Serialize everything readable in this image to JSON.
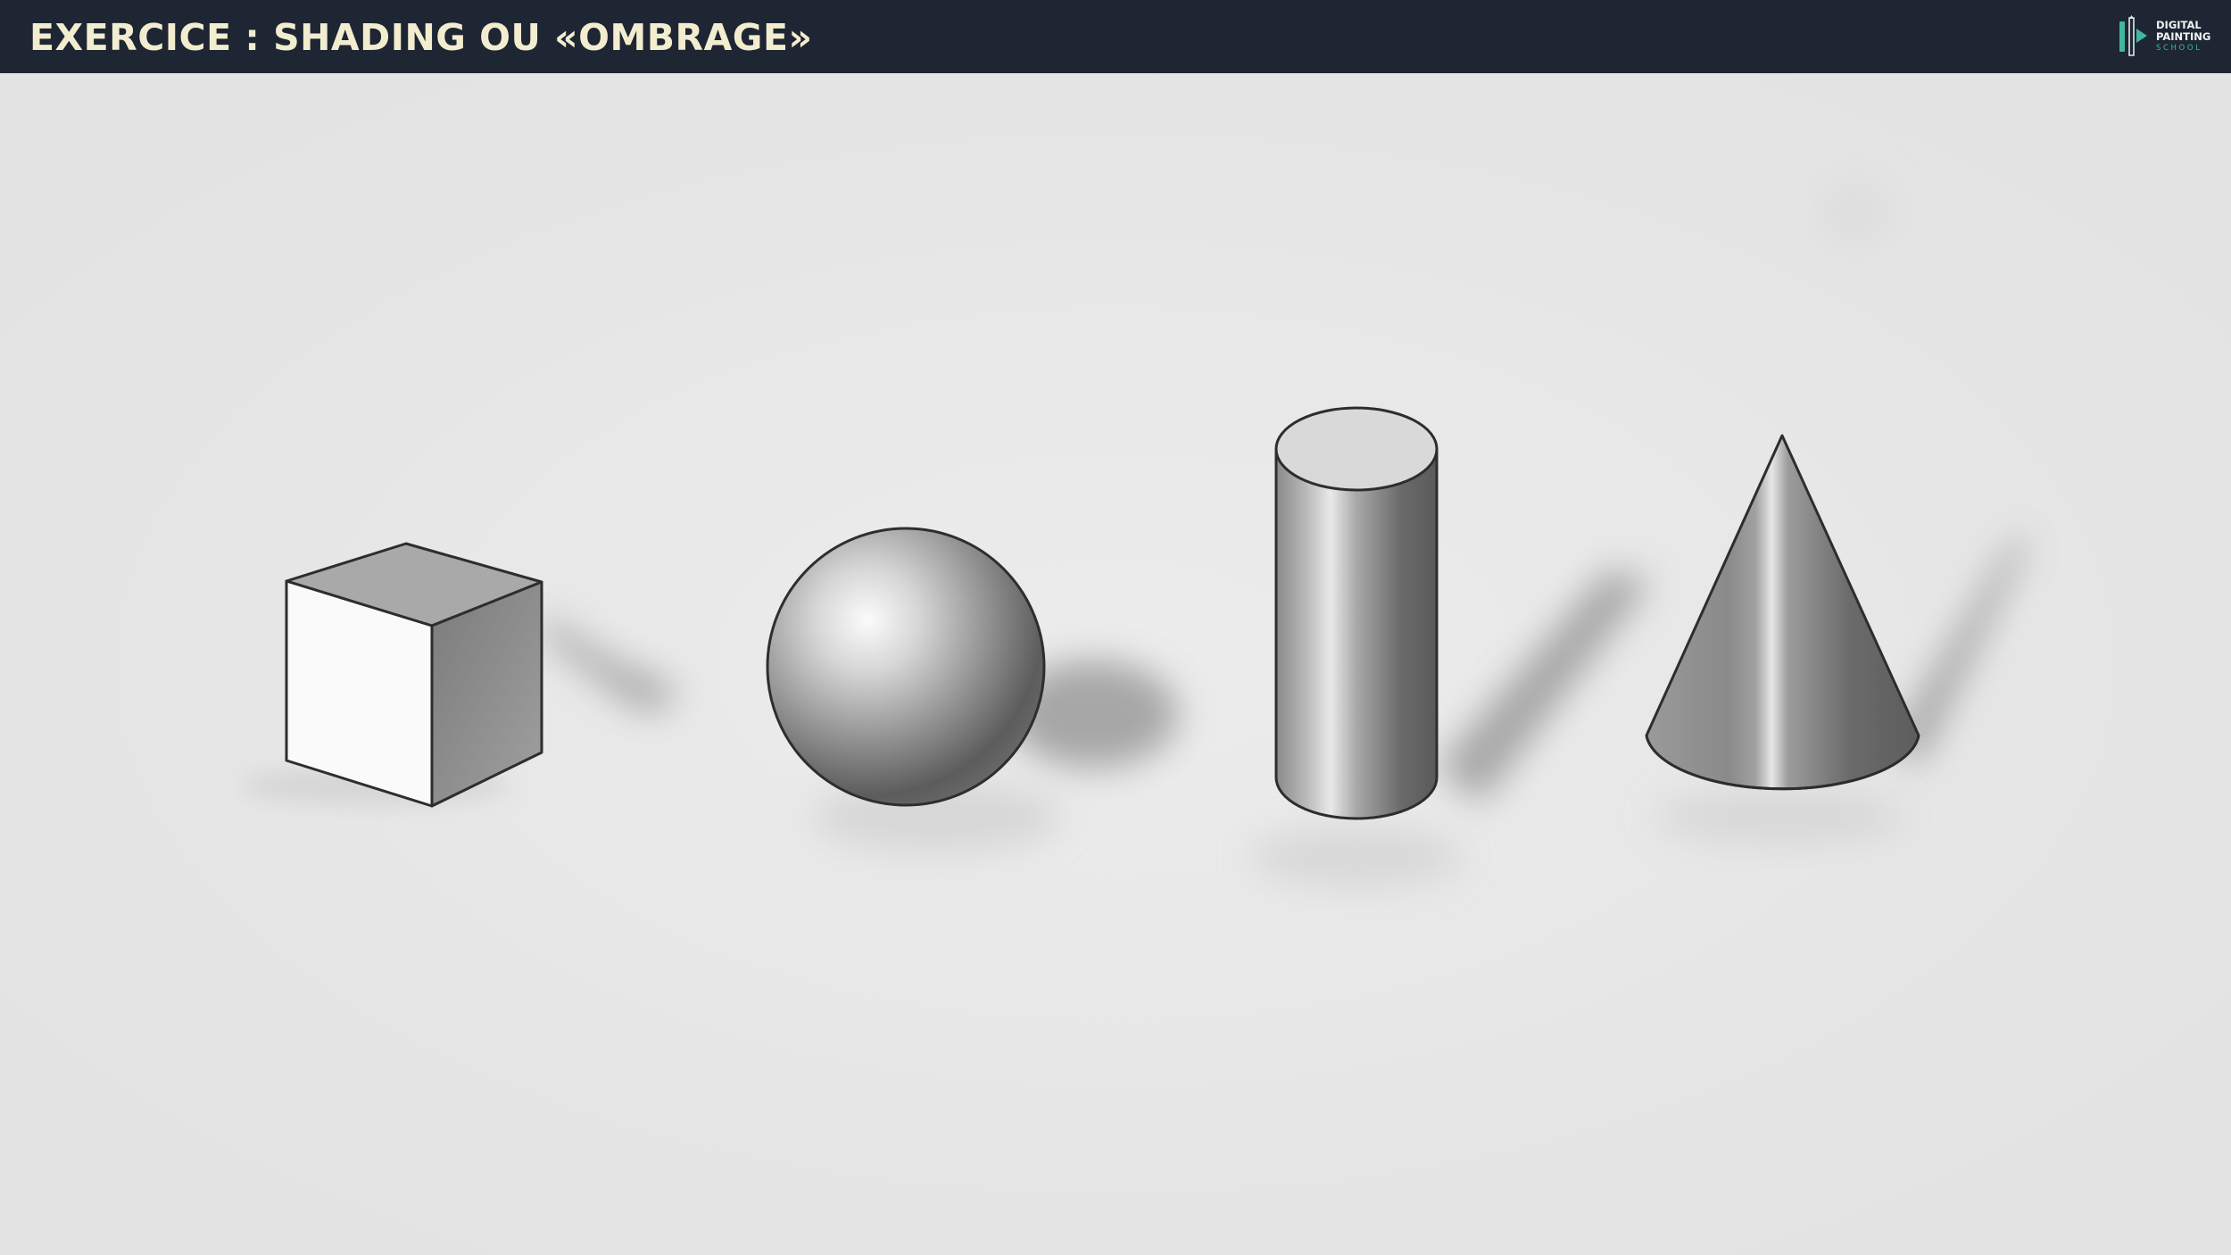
{
  "header": {
    "title": "EXERCICE : SHADING OU «OMBRAGE»",
    "background_color": "#1e2533",
    "title_color": "#f3edd0"
  },
  "logo": {
    "line1": "DIGITAL",
    "line2": "PAINTING",
    "line3": "SCHOOL",
    "accent_color": "#3fb89f",
    "icon": "paintbrush-logo-icon"
  },
  "scene": {
    "background_color": "#e6e6e6",
    "shapes": [
      "cube",
      "sphere",
      "cylinder",
      "cone"
    ]
  }
}
